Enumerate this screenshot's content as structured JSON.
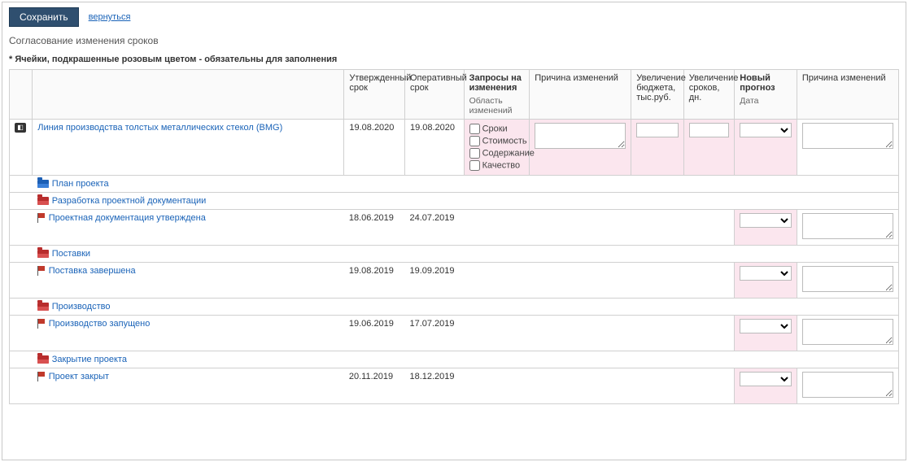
{
  "toolbar": {
    "save_label": "Сохранить",
    "back_label": "вернуться"
  },
  "page_title": "Согласование изменения сроков",
  "hint": "* Ячейки, подкрашенные розовым цветом - обязательны для заполнения",
  "headers": {
    "approved": "Утвержденный срок",
    "operational": "Оперативный срок",
    "requests": "Запросы на изменения",
    "requests_sub": "Область изменений",
    "reason": "Причина изменений",
    "budget_inc": "Увеличение бюджета, тыс.руб.",
    "days_inc": "Увеличение сроков, дн.",
    "new_forecast": "Новый прогноз",
    "new_forecast_sub": "Дата",
    "reason2": "Причина изменений"
  },
  "checkboxes": {
    "dates": "Сроки",
    "cost": "Стоимость",
    "scope": "Содержание",
    "quality": "Качество"
  },
  "project": {
    "name": "Линия производства толстых металлических стекол (BMG)",
    "approved": "19.08.2020",
    "operational": "19.08.2020",
    "reason": "",
    "budget_inc": "",
    "days_inc": "",
    "forecast": "",
    "reason2": ""
  },
  "tree": [
    {
      "type": "plan",
      "label": "План проекта",
      "children": [
        {
          "type": "folder",
          "label": "Разработка проектной документации",
          "children": [
            {
              "type": "milestone",
              "label": "Проектная документация утверждена",
              "approved": "18.06.2019",
              "operational": "24.07.2019",
              "forecast": "",
              "reason2": ""
            }
          ]
        },
        {
          "type": "folder",
          "label": "Поставки",
          "children": [
            {
              "type": "milestone",
              "label": "Поставка завершена",
              "approved": "19.08.2019",
              "operational": "19.09.2019",
              "forecast": "",
              "reason2": ""
            }
          ]
        },
        {
          "type": "folder",
          "label": "Производство",
          "children": [
            {
              "type": "milestone",
              "label": "Производство запущено",
              "approved": "19.06.2019",
              "operational": "17.07.2019",
              "forecast": "",
              "reason2": ""
            }
          ]
        },
        {
          "type": "folder",
          "label": "Закрытие проекта",
          "children": [
            {
              "type": "milestone",
              "label": "Проект закрыт",
              "approved": "20.11.2019",
              "operational": "18.12.2019",
              "forecast": "",
              "reason2": ""
            }
          ]
        }
      ]
    }
  ]
}
